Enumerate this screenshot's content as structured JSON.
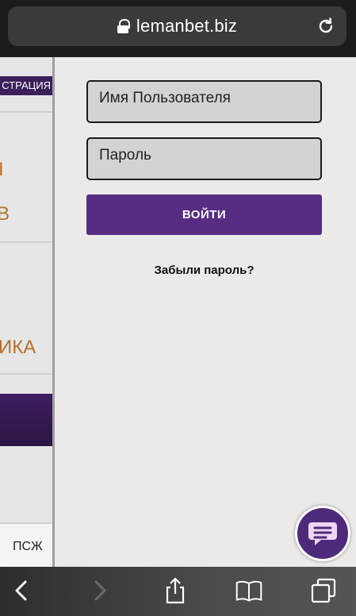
{
  "browser": {
    "url": "lemanbet.biz",
    "icons": {
      "lock": "lock-icon",
      "reload": "reload-icon"
    },
    "toolbar": [
      "back-icon",
      "forward-icon",
      "share-icon",
      "bookmarks-icon",
      "tabs-icon"
    ]
  },
  "background_page": {
    "register_tab": "СТРАЦИЯ",
    "orange_1": "I",
    "orange_2": "В",
    "orange_3": "ИКА",
    "bottom_link": "ПСЖ"
  },
  "login": {
    "username_placeholder": "Имя Пользователя",
    "password_placeholder": "Пароль",
    "submit_label": "ВОЙТИ",
    "forgot_label": "Забыли пароль?"
  },
  "chat": {
    "icon": "chat-icon"
  },
  "colors": {
    "accent": "#572d83",
    "orange_text": "#b8702e",
    "panel_bg": "#ebeae9",
    "input_bg": "#d3d3d3"
  }
}
